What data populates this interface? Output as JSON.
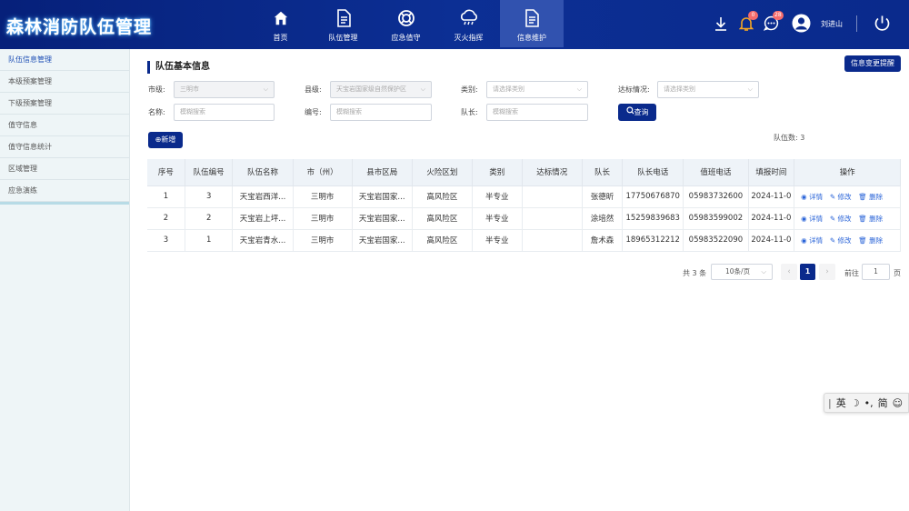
{
  "app": {
    "title": "森林消防队伍管理"
  },
  "nav": {
    "items": [
      {
        "label": "首页",
        "icon": "home-icon"
      },
      {
        "label": "队伍管理",
        "icon": "document-icon"
      },
      {
        "label": "应急值守",
        "icon": "lifebuoy-icon"
      },
      {
        "label": "灭火指挥",
        "icon": "cloud-rain-icon"
      },
      {
        "label": "信息维护",
        "icon": "document-icon",
        "active": true
      }
    ]
  },
  "header": {
    "notification_count": "0",
    "message_count": "28",
    "user_name": "刘进山"
  },
  "sidebar": {
    "items": [
      {
        "label": "队伍信息管理",
        "active": true
      },
      {
        "label": "本级预案管理"
      },
      {
        "label": "下级预案管理"
      },
      {
        "label": "值守信息"
      },
      {
        "label": "值守信息统计"
      },
      {
        "label": "区域管理"
      },
      {
        "label": "应急演练"
      }
    ]
  },
  "page": {
    "section_title": "队伍基本信息",
    "change_reminder_button": "信息变更提醒",
    "add_button": "⊕新增",
    "team_count": "队伍数: 3"
  },
  "filters": {
    "city_label": "市级:",
    "city_value": "三明市",
    "county_label": "县级:",
    "county_value": "天宝岩国家级自然保护区",
    "category_label": "类别:",
    "category_placeholder": "请选择类别",
    "standard_label": "达标情况:",
    "standard_placeholder": "请选择类别",
    "name_label": "名称:",
    "name_placeholder": "模糊搜索",
    "code_label": "编号:",
    "code_placeholder": "模糊搜索",
    "captain_label": "队长:",
    "captain_placeholder": "模糊搜索",
    "query_button": "查询"
  },
  "table": {
    "headers": [
      "序号",
      "队伍编号",
      "队伍名称",
      "市（州）",
      "县市区局",
      "火险区划",
      "类别",
      "达标情况",
      "队长",
      "队长电话",
      "值班电话",
      "填报时间",
      "操作"
    ],
    "rows": [
      {
        "seq": "1",
        "code": "3",
        "name": "天宝岩西洋...",
        "city": "三明市",
        "county": "天宝岩国家...",
        "fire_zone": "高风险区",
        "category": "半专业",
        "standard": "",
        "captain": "张德昕",
        "captain_phone": "17750676870",
        "duty_phone": "05983732600",
        "filled_time": "2024-11-0"
      },
      {
        "seq": "2",
        "code": "2",
        "name": "天宝岩上坪...",
        "city": "三明市",
        "county": "天宝岩国家...",
        "fire_zone": "高风险区",
        "category": "半专业",
        "standard": "",
        "captain": "涂培然",
        "captain_phone": "15259839683",
        "duty_phone": "05983599002",
        "filled_time": "2024-11-0"
      },
      {
        "seq": "3",
        "code": "1",
        "name": "天宝岩青水...",
        "city": "三明市",
        "county": "天宝岩国家...",
        "fire_zone": "高风险区",
        "category": "半专业",
        "standard": "",
        "captain": "詹术森",
        "captain_phone": "18965312212",
        "duty_phone": "05983522090",
        "filled_time": "2024-11-0"
      }
    ],
    "actions": {
      "detail": "详情",
      "edit": "修改",
      "delete": "删除"
    }
  },
  "pagination": {
    "total": "共 3 条",
    "page_size": "10条/页",
    "current_page": "1",
    "goto_label": "前往",
    "goto_value": "1",
    "page_unit": "页"
  },
  "ime": {
    "lang": "英",
    "mode": "简"
  },
  "colors": {
    "primary": "#0a2a8c",
    "accent_link": "#2a64d8",
    "badge": "#f56c6c"
  }
}
